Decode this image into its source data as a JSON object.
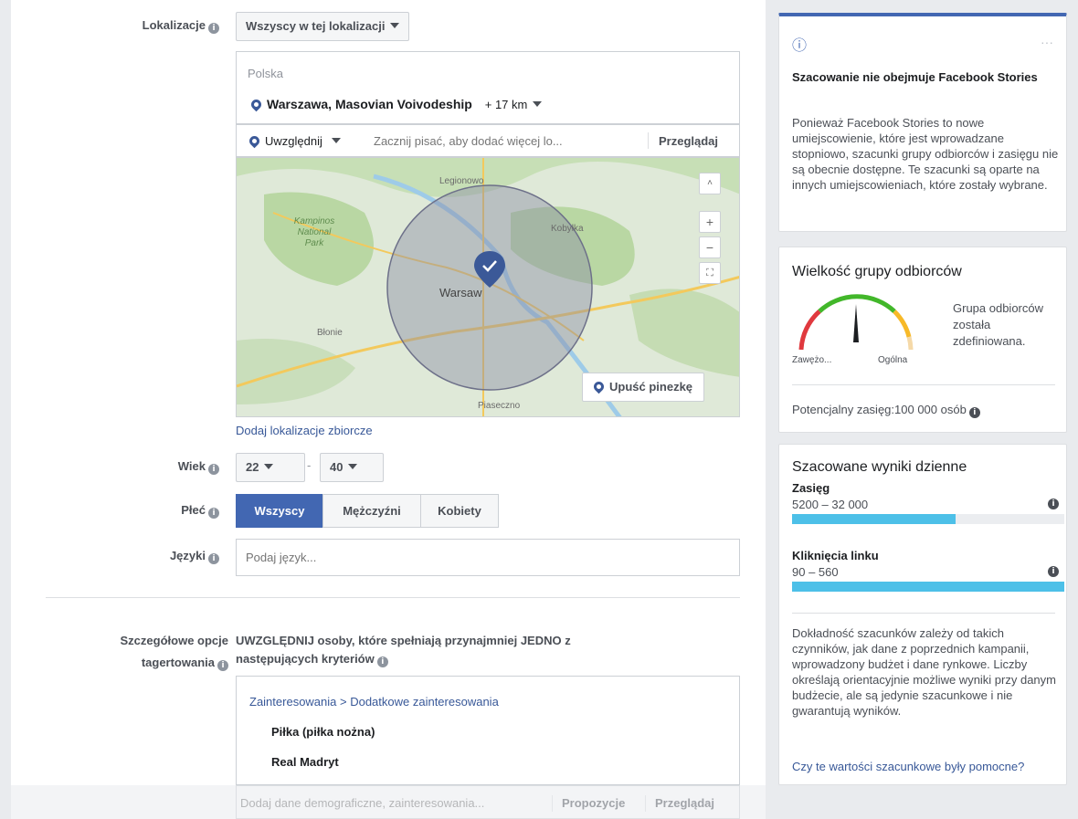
{
  "form": {
    "location_label": "Lokalizacje",
    "location_type": "Wszyscy w tej lokalizacji",
    "country": "Polska",
    "city": "Warszawa, Masovian Voivodeship",
    "radius": "+ 17 km",
    "include": "Uwzględnij",
    "location_placeholder": "Zacznij pisać, aby dodać więcej lo...",
    "browse": "Przeglądaj",
    "map_labels": {
      "legionowo": "Legionowo",
      "kampinos": "Kampinos National Park",
      "kobylka": "Kobyłka",
      "warsaw": "Warsaw",
      "blonie": "Błonie",
      "piaseczno": "Piaseczno"
    },
    "drop_pin": "Upuść pinezkę",
    "add_bulk": "Dodaj lokalizacje zbiorcze",
    "age_label": "Wiek",
    "age_min": "22",
    "age_sep": "-",
    "age_max": "40",
    "gender_label": "Płeć",
    "gender_options": [
      "Wszyscy",
      "Mężczyźni",
      "Kobiety"
    ],
    "languages_label": "Języki",
    "languages_placeholder": "Podaj język...",
    "detailed_label_1": "Szczegółowe opcje",
    "detailed_label_2": "tagertowania",
    "include_text_1": "UWZGLĘDNIJ osoby, które spełniają przynajmniej JEDNO z",
    "include_text_2": "następujących kryteriów",
    "breadcrumb": "Zainteresowania > Dodatkowe zainteresowania",
    "interests": [
      "Piłka (piłka nożna)",
      "Real Madryt"
    ],
    "add_demo_placeholder": "Dodaj dane demograficzne, zainteresowania...",
    "suggestions": "Propozycje",
    "browse2": "Przeglądaj"
  },
  "side": {
    "notice_icon": "ⓘ",
    "notice_more": "···",
    "notice_title": "Szacowanie nie obejmuje Facebook Stories",
    "notice_body": "Ponieważ Facebook Stories to nowe umiejscowienie, które jest wprowadzane stopniowo, szacunki grupy odbiorców i zasięgu nie są obecnie dostępne. Te szacunki są oparte na innych umiejscowieniach, które zostały wybrane.",
    "audience_title": "Wielkość grupy odbiorców",
    "gauge_left": "Zawężo...",
    "gauge_right": "Ogólna",
    "audience_status": "Grupa odbiorców została zdefiniowana.",
    "potential_reach": "Potencjalny zasięg:100 000 osób",
    "daily_title": "Szacowane wyniki dzienne",
    "reach_label": "Zasięg",
    "reach_value": "5200 – 32 000",
    "reach_fill": 0.6,
    "clicks_label": "Kliknięcia linku",
    "clicks_value": "90 – 560",
    "clicks_fill": 1.0,
    "accuracy_text": "Dokładność szacunków zależy od takich czynników, jak dane z poprzednich kampanii, wprowadzony budżet i dane rynkowe. Liczby określają orientacyjnie możliwe wyniki przy danym budżecie, ale są jedynie szacunkowe i nie gwarantują wyników.",
    "feedback_link": "Czy te wartości szacunkowe były pomocne?"
  },
  "colors": {
    "accent": "#4267b2",
    "bar": "#4dc0e8",
    "link": "#385898"
  }
}
